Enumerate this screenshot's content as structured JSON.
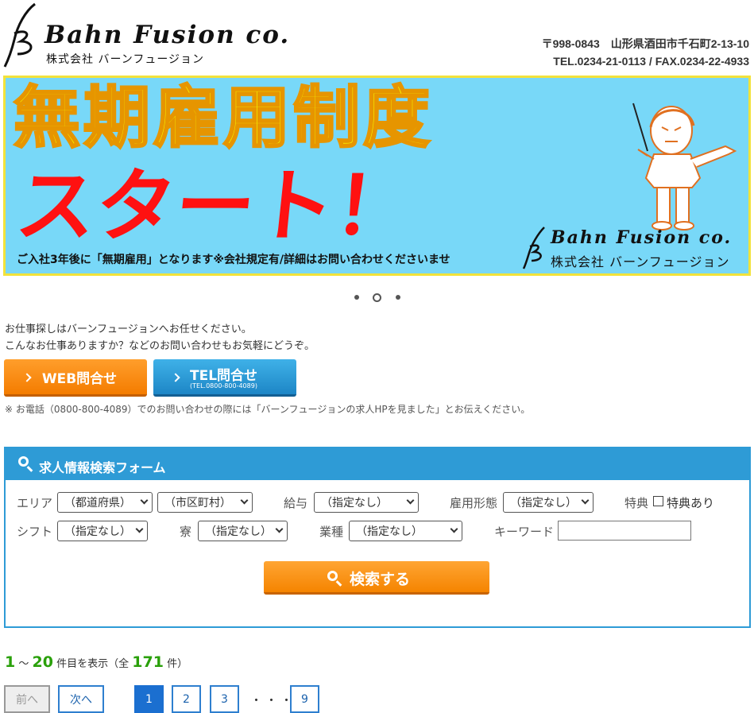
{
  "header": {
    "logo_name": "Bahn Fusion co.",
    "logo_sub": "株式会社 バーンフュージョン",
    "address": "〒998-0843　山形県酒田市千石町2-13-10",
    "contact": "TEL.0234-21-0113 / FAX.0234-22-4933"
  },
  "banner": {
    "title": "無期雇用制度",
    "headline": "スタート！",
    "note": "ご入社3年後に「無期雇用」となります※会社規定有/詳細はお問い合わせくださいませ",
    "logo_name": "Bahn Fusion co.",
    "logo_sub": "株式会社 バーンフュージョン",
    "slides_total": 3,
    "active_slide": 2
  },
  "intro": {
    "line1": "お仕事探しはバーンフュージョンへお任せください。",
    "line2": "こんなお仕事ありますか？などのお問い合わせもお気軽にどうぞ。",
    "web_button": "WEB問合せ",
    "tel_button": "TEL問合せ",
    "tel_button_sub": "(TEL.0800-800-4089)",
    "phone_note": "※ お電話（0800-800-4089）でのお問い合わせの際には「バーンフュージョンの求人HPを見ました」とお伝えください。"
  },
  "search_form": {
    "title": "求人情報検索フォーム",
    "area_label": "エリア",
    "prefecture_value": "（都道府県）",
    "city_value": "（市区町村）",
    "salary_label": "給与",
    "salary_value": "（指定なし）",
    "employment_label": "雇用形態",
    "employment_value": "（指定なし）",
    "benefit_label": "特典",
    "benefit_option": "特典あり",
    "shift_label": "シフト",
    "shift_value": "（指定なし）",
    "dorm_label": "寮",
    "dorm_value": "（指定なし）",
    "industry_label": "業種",
    "industry_value": "（指定なし）",
    "keyword_label": "キーワード",
    "keyword_value": "",
    "submit_label": "検索する"
  },
  "results": {
    "from": "1",
    "sep": "～",
    "to": "20",
    "shown_suffix": "件目を表示（全",
    "total": "171",
    "total_suffix": "件）"
  },
  "pagination": {
    "prev": "前へ",
    "next": "次へ",
    "pages": [
      "1",
      "2",
      "3"
    ],
    "ellipsis": "・・・",
    "last": "9",
    "current": 1
  },
  "colors": {
    "accent_blue": "#2e9bd6",
    "accent_orange": "#f47c00",
    "banner_bg": "#78d8f8",
    "banner_title": "#f5f000",
    "banner_headline": "#ff1111",
    "count_green": "#2aa00a"
  }
}
